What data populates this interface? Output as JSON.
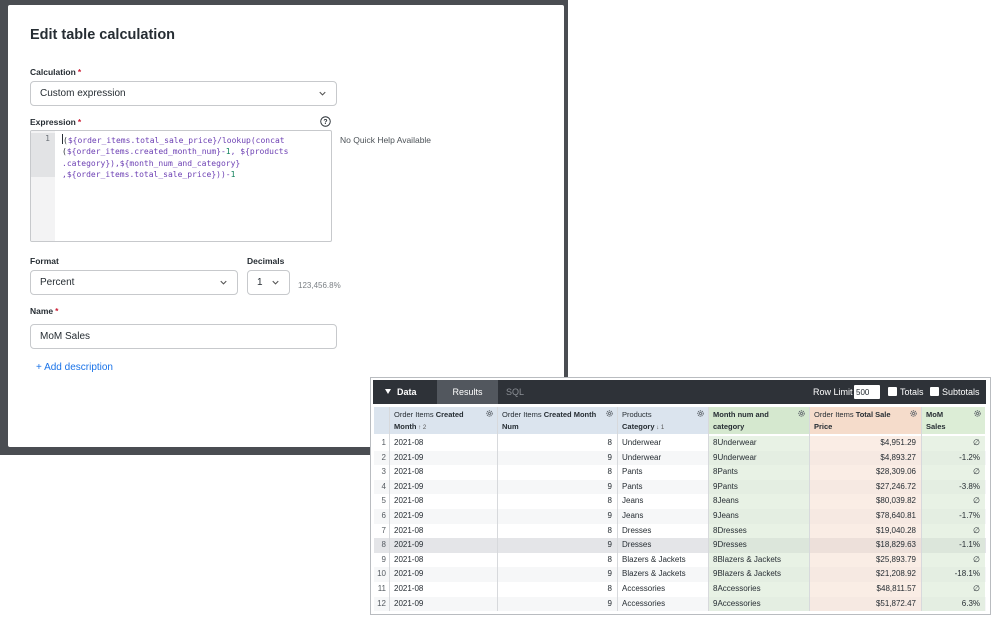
{
  "modal": {
    "title": "Edit table calculation",
    "calculation": {
      "label": "Calculation",
      "required": "*",
      "value": "Custom expression"
    },
    "expression": {
      "label": "Expression",
      "required": "*",
      "line_number": "1",
      "lines": [
        "(${order_items.total_sale_price}/lookup(concat",
        "(${order_items.created_month_num}-1, ${products",
        ".category}),${month_num_and_category}",
        ",${order_items.total_sale_price}))-1"
      ],
      "quick_help": "No Quick Help Available",
      "help_icon": "question-circle-icon"
    },
    "format": {
      "label": "Format",
      "value": "Percent"
    },
    "decimals": {
      "label": "Decimals",
      "value": "1",
      "preview": "123,456.8%"
    },
    "name": {
      "label": "Name",
      "required": "*",
      "value": "MoM Sales"
    },
    "add_description": "+ Add description"
  },
  "data_panel": {
    "title": "Data",
    "tabs": [
      "Results",
      "SQL"
    ],
    "active_tab": "Results",
    "row_limit_label": "Row Limit",
    "row_limit_value": "500",
    "totals_label": "Totals",
    "subtotals_label": "Subtotals",
    "columns": [
      {
        "pre": "Order Items ",
        "bold": "Created",
        "line2_bold": "Month",
        "sort": "↑ 2",
        "color": "blue"
      },
      {
        "pre": "Order Items ",
        "bold": "Created Month",
        "line2_bold": "Num",
        "sort": "",
        "color": "blue"
      },
      {
        "pre": "Products",
        "bold": "",
        "line2_bold": "Category",
        "sort": "↓ 1",
        "color": "blue"
      },
      {
        "pre": "",
        "bold": "Month num and",
        "line2_bold": "category",
        "sort": "",
        "color": "green"
      },
      {
        "pre": "Order Items ",
        "bold": "Total Sale",
        "line2_bold": "Price",
        "sort": "",
        "color": "peach"
      },
      {
        "pre": "",
        "bold": "MoM",
        "line2_bold": "Sales",
        "sort": "",
        "color": "lgreen"
      }
    ],
    "rows": [
      {
        "n": "1",
        "month": "2021-08",
        "num": "8",
        "category": "Underwear",
        "key": "8Underwear",
        "price": "$4,951.29",
        "mom": "∅"
      },
      {
        "n": "2",
        "month": "2021-09",
        "num": "9",
        "category": "Underwear",
        "key": "9Underwear",
        "price": "$4,893.27",
        "mom": "-1.2%"
      },
      {
        "n": "3",
        "month": "2021-08",
        "num": "8",
        "category": "Pants",
        "key": "8Pants",
        "price": "$28,309.06",
        "mom": "∅"
      },
      {
        "n": "4",
        "month": "2021-09",
        "num": "9",
        "category": "Pants",
        "key": "9Pants",
        "price": "$27,246.72",
        "mom": "-3.8%"
      },
      {
        "n": "5",
        "month": "2021-08",
        "num": "8",
        "category": "Jeans",
        "key": "8Jeans",
        "price": "$80,039.82",
        "mom": "∅"
      },
      {
        "n": "6",
        "month": "2021-09",
        "num": "9",
        "category": "Jeans",
        "key": "9Jeans",
        "price": "$78,640.81",
        "mom": "-1.7%"
      },
      {
        "n": "7",
        "month": "2021-08",
        "num": "8",
        "category": "Dresses",
        "key": "8Dresses",
        "price": "$19,040.28",
        "mom": "∅"
      },
      {
        "n": "8",
        "month": "2021-09",
        "num": "9",
        "category": "Dresses",
        "key": "9Dresses",
        "price": "$18,829.63",
        "mom": "-1.1%"
      },
      {
        "n": "9",
        "month": "2021-08",
        "num": "8",
        "category": "Blazers & Jackets",
        "key": "8Blazers & Jackets",
        "price": "$25,893.79",
        "mom": "∅"
      },
      {
        "n": "10",
        "month": "2021-09",
        "num": "9",
        "category": "Blazers & Jackets",
        "key": "9Blazers & Jackets",
        "price": "$21,208.92",
        "mom": "-18.1%"
      },
      {
        "n": "11",
        "month": "2021-08",
        "num": "8",
        "category": "Accessories",
        "key": "8Accessories",
        "price": "$48,811.57",
        "mom": "∅"
      },
      {
        "n": "12",
        "month": "2021-09",
        "num": "9",
        "category": "Accessories",
        "key": "9Accessories",
        "price": "$51,872.47",
        "mom": "6.3%"
      }
    ]
  }
}
